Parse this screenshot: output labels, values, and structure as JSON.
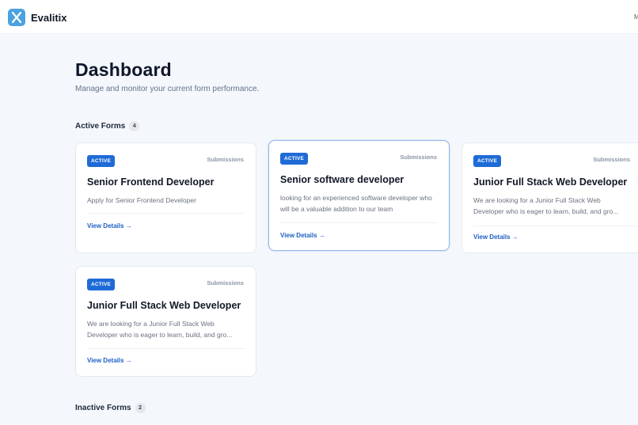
{
  "app": {
    "brand": "Evalitix",
    "top_right_text": "M"
  },
  "header": {
    "title": "Dashboard",
    "subtitle": "Manage and monitor your current form performance."
  },
  "sections": {
    "active": {
      "label": "Active Forms",
      "count": "4"
    },
    "inactive": {
      "label": "Inactive Forms",
      "count": "2"
    }
  },
  "colors": {
    "accent": "#1e6bd6",
    "logo": "#4aa3df"
  },
  "cards": [
    {
      "status": "ACTIVE",
      "submissions_label": "Submissions",
      "title": "Senior Frontend Developer",
      "description": "Apply for Senior Frontend Developer",
      "link": "View Details →"
    },
    {
      "status": "ACTIVE",
      "submissions_label": "Submissions",
      "title": "Senior software developer",
      "description": "looking for an experienced software developer who will be a valuable addition to our team",
      "link": "View Details →"
    },
    {
      "status": "ACTIVE",
      "submissions_label": "Submissions",
      "title": "Junior Full Stack Web Developer",
      "description": "We are looking for a Junior Full Stack Web Developer who is eager to learn, build, and gro...",
      "link": "View Details →"
    },
    {
      "status": "ACTIVE",
      "submissions_label": "Submissions",
      "title": "Junior Full Stack Web Developer",
      "description": "We are looking for a Junior Full Stack Web Developer who is eager to learn, build, and gro...",
      "link": "View Details →"
    }
  ]
}
